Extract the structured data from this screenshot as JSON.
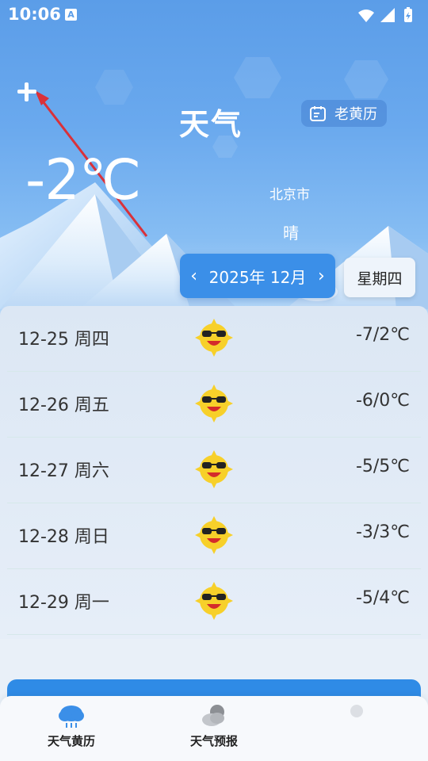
{
  "status_bar": {
    "time": "10:06",
    "notification_icon": "A"
  },
  "header": {
    "title": "天气",
    "almanac_button": "老黄历"
  },
  "current": {
    "temperature": "-2℃",
    "city": "北京市",
    "condition": "晴"
  },
  "calendar": {
    "month_label": "2025年 12月",
    "weekday": "星期四"
  },
  "forecast": [
    {
      "date": "12-25  周四",
      "icon": "sun-sunglasses-icon",
      "range": "-7/2℃"
    },
    {
      "date": "12-26  周五",
      "icon": "sun-sunglasses-icon",
      "range": "-6/0℃"
    },
    {
      "date": "12-27  周六",
      "icon": "sun-sunglasses-icon",
      "range": "-5/5℃"
    },
    {
      "date": "12-28  周日",
      "icon": "sun-sunglasses-icon",
      "range": "-3/3℃"
    },
    {
      "date": "12-29  周一",
      "icon": "sun-sunglasses-icon",
      "range": "-5/4℃"
    }
  ],
  "bottom_nav": {
    "items": [
      {
        "label": "天气黄历",
        "icon": "rain-cloud-icon"
      },
      {
        "label": "天气预报",
        "icon": "cloud-moon-icon"
      }
    ]
  },
  "colors": {
    "accent": "#3b8fe8",
    "sky_top": "#5b9de8",
    "divider": "#d6e8ea"
  }
}
